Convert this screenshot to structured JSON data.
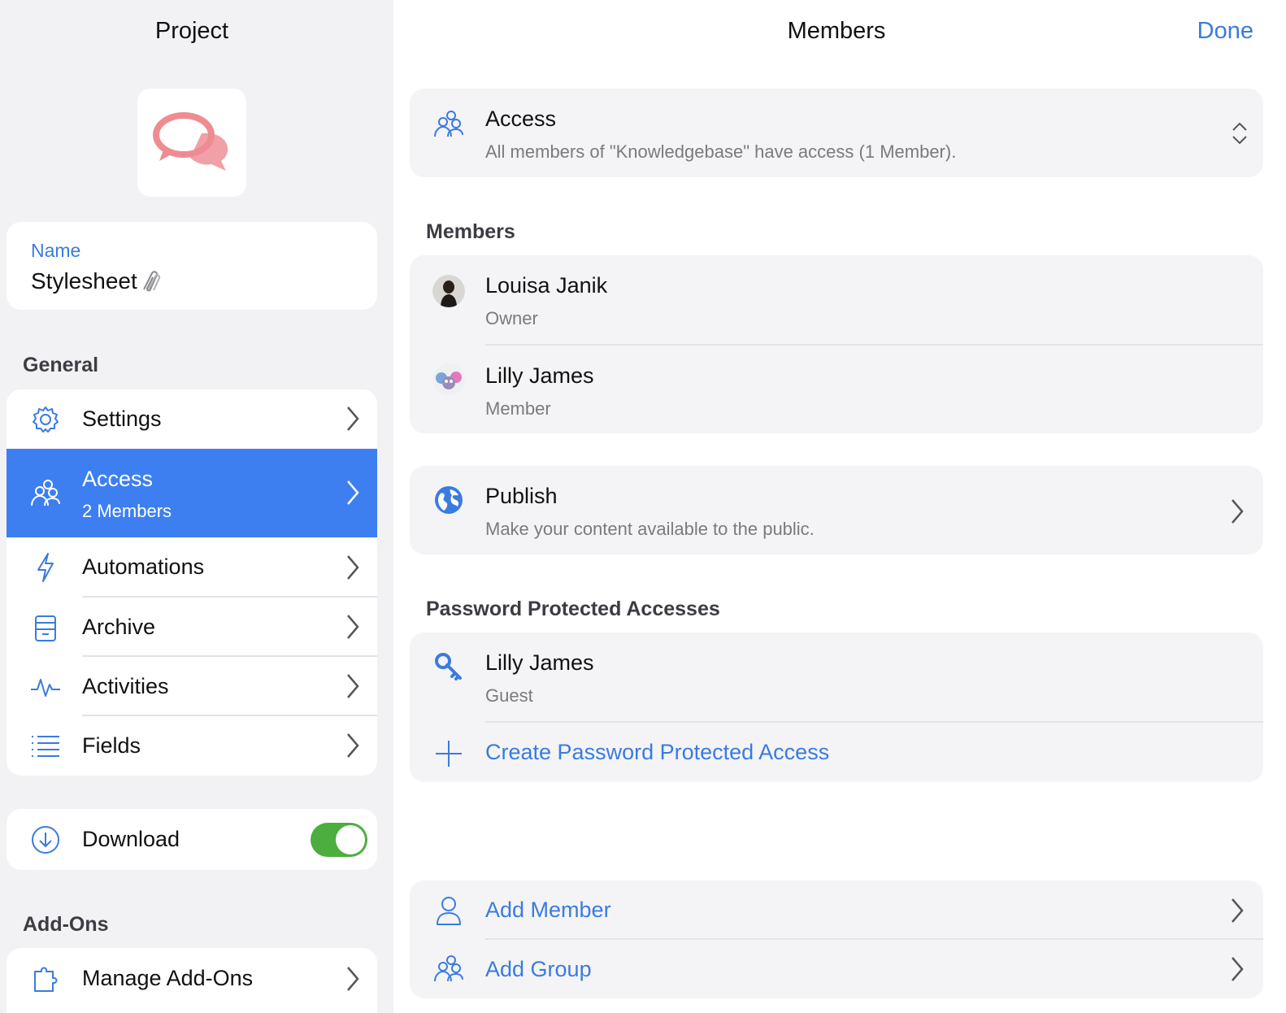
{
  "left": {
    "title": "Project",
    "app_icon": "chat-bubbles-icon",
    "name_label": "Name",
    "name_value": "Stylesheet",
    "name_emoji": "paperclip-icon",
    "general_header": "General",
    "general_items": [
      {
        "label": "Settings",
        "icon": "gear-icon"
      },
      {
        "label": "Access",
        "sub": "2 Members",
        "icon": "group-icon",
        "active": true
      },
      {
        "label": "Automations",
        "icon": "bolt-icon"
      },
      {
        "label": "Archive",
        "icon": "archive-icon"
      },
      {
        "label": "Activities",
        "icon": "activity-icon"
      },
      {
        "label": "Fields",
        "icon": "list-icon"
      }
    ],
    "download_label": "Download",
    "download_enabled": true,
    "addons_header": "Add-Ons",
    "manage_addons_label": "Manage Add-Ons"
  },
  "right": {
    "title": "Members",
    "done_label": "Done",
    "access_title": "Access",
    "access_desc": "All members of \"Knowledgebase\" have access (1 Member).",
    "members_header": "Members",
    "members": [
      {
        "name": "Louisa Janik",
        "role": "Owner"
      },
      {
        "name": "Lilly James",
        "role": "Member"
      }
    ],
    "publish_title": "Publish",
    "publish_desc": "Make your content available to the public.",
    "password_header": "Password Protected Accesses",
    "password_entries": [
      {
        "name": "Lilly James",
        "role": "Guest"
      }
    ],
    "create_password_label": "Create Password Protected Access",
    "add_member_label": "Add Member",
    "add_group_label": "Add Group"
  },
  "colors": {
    "accent": "#3a7bdf",
    "active_row": "#3d7ff0",
    "toggle_on": "#4cae3e",
    "app_icon": "#ef8f94"
  }
}
